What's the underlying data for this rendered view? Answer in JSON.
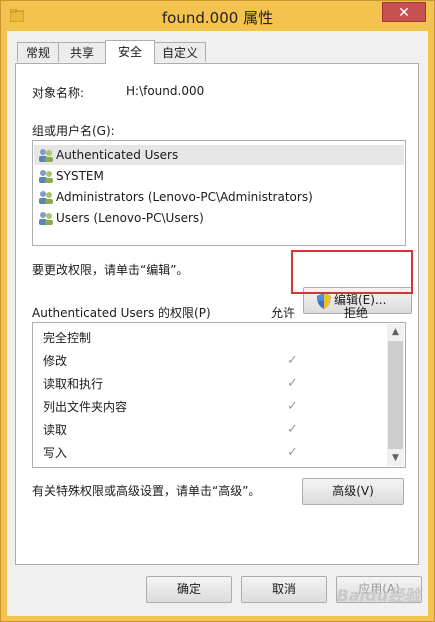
{
  "window": {
    "title": "found.000 属性",
    "close_label": "✕"
  },
  "tabs": [
    {
      "label": "常规"
    },
    {
      "label": "共享"
    },
    {
      "label": "安全"
    },
    {
      "label": "自定义"
    }
  ],
  "security": {
    "object_name_label": "对象名称:",
    "object_name_value": "H:\\found.000",
    "group_label": "组或用户名(G):",
    "users": [
      {
        "name": "Authenticated Users"
      },
      {
        "name": "SYSTEM"
      },
      {
        "name": "Administrators (Lenovo-PC\\Administrators)"
      },
      {
        "name": "Users (Lenovo-PC\\Users)"
      }
    ],
    "change_hint": "要更改权限，请单击“编辑”。",
    "edit_button": "编辑(E)...",
    "perm_title": "Authenticated Users 的权限(P)",
    "allow_header": "允许",
    "deny_header": "拒绝",
    "permissions": [
      {
        "name": "完全控制",
        "allow": false
      },
      {
        "name": "修改",
        "allow": true
      },
      {
        "name": "读取和执行",
        "allow": true
      },
      {
        "name": "列出文件夹内容",
        "allow": true
      },
      {
        "name": "读取",
        "allow": true
      },
      {
        "name": "写入",
        "allow": true
      }
    ],
    "advanced_hint": "有关特殊权限或高级设置，请单击“高级”。",
    "advanced_button": "高级(V)"
  },
  "footer": {
    "ok": "确定",
    "cancel": "取消",
    "apply": "应用(A)"
  },
  "watermark": "Baidu经验",
  "colors": {
    "frame": "#f3c24f",
    "close": "#c75050",
    "highlight": "#d83232"
  }
}
